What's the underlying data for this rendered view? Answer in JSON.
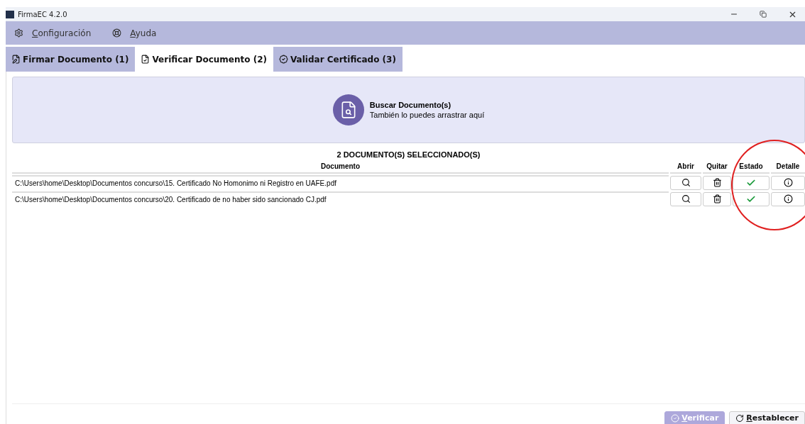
{
  "window": {
    "title": "FirmaEC 4.2.0"
  },
  "menu": [
    {
      "label": "Configuración",
      "kind": "gear"
    },
    {
      "label": "Ayuda",
      "kind": "help"
    }
  ],
  "tabs": [
    {
      "label": "Firmar Documento (1)",
      "kind": "sign",
      "selected": false
    },
    {
      "label": "Verificar Documento (2)",
      "kind": "verify",
      "selected": true
    },
    {
      "label": "Validar Certificado (3)",
      "kind": "validate",
      "selected": false
    }
  ],
  "drop_zone": {
    "title": "Buscar Documento(s)",
    "subtitle": "También lo puedes arrastrar aquí"
  },
  "count_heading": "2 DOCUMENTO(S) SELECCIONADO(S)",
  "table": {
    "columns": [
      "Documento",
      "Abrir",
      "Quitar",
      "Estado",
      "Detalle"
    ],
    "rows": [
      {
        "path": "C:\\Users\\home\\Desktop\\Documentos concurso\\15. Certificado No Homonimo ni Registro en UAFE.pdf",
        "valid": true
      },
      {
        "path": "C:\\Users\\home\\Desktop\\Documentos concurso\\20. Certificado de no haber sido sancionado CJ.pdf",
        "valid": true
      }
    ]
  },
  "buttons": [
    {
      "label": "Verificar",
      "kind": "verify",
      "disabled": true
    },
    {
      "label": "Restablecer",
      "kind": "reset",
      "disabled": false
    }
  ]
}
